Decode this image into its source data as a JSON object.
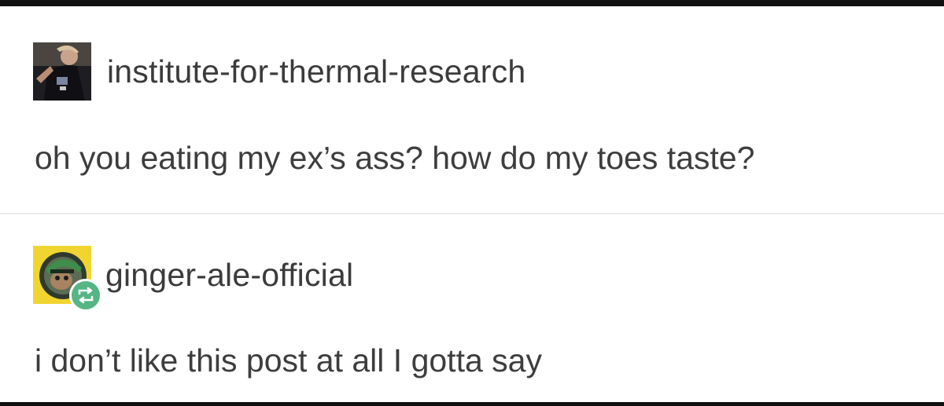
{
  "posts": [
    {
      "username": "institute-for-thermal-research",
      "text": "oh you eating my ex’s ass? how do my toes taste?",
      "avatar_icon": "profile-photo-icon"
    },
    {
      "username": "ginger-ale-official",
      "text": "i don’t like this post at all I gotta say",
      "avatar_icon": "profile-photo-icon",
      "badge_icon": "reblog-icon"
    }
  ],
  "colors": {
    "text": "#3d3d3d",
    "reblog_badge": "#55b584",
    "avatar_yellow": "#f0d531"
  }
}
